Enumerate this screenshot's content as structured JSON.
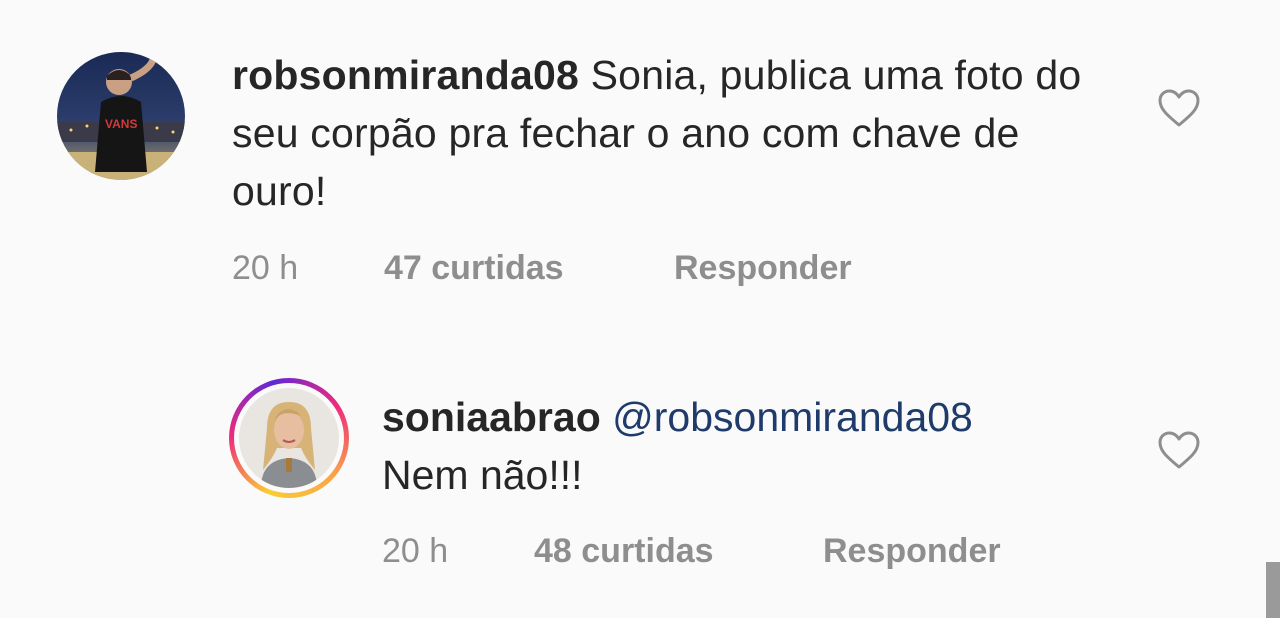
{
  "comments": [
    {
      "username": "robsonmiranda08",
      "text": "Sonia, publica uma foto do seu corpão pra fechar o ano com chave de ouro!",
      "time": "20 h",
      "likes": "47 curtidas",
      "reply": "Responder"
    },
    {
      "username": "soniaabrao",
      "mention": "@robsonmiranda08",
      "text": "Nem não!!!",
      "time": "20 h",
      "likes": "48 curtidas",
      "reply": "Responder"
    }
  ],
  "icons": {
    "like": "heart-outline-icon"
  },
  "colors": {
    "mention": "#1f3b6b",
    "meta": "#8e8e8e"
  }
}
